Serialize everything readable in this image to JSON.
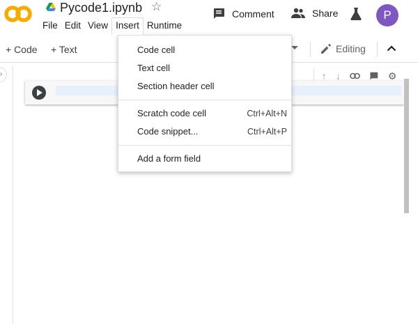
{
  "header": {
    "notebook_title": "Pycode1.ipynb",
    "comment_label": "Comment",
    "share_label": "Share",
    "avatar_letter": "P"
  },
  "menubar": {
    "items": [
      "File",
      "Edit",
      "View",
      "Insert",
      "Runtime"
    ],
    "open_item": "Insert"
  },
  "toolbar": {
    "add_code_label": "+ Code",
    "add_text_label": "+ Text",
    "mode_label": "Editing"
  },
  "insert_menu": {
    "groups": [
      [
        {
          "label": "Code cell",
          "shortcut": ""
        },
        {
          "label": "Text cell",
          "shortcut": ""
        },
        {
          "label": "Section header cell",
          "shortcut": ""
        }
      ],
      [
        {
          "label": "Scratch code cell",
          "shortcut": "Ctrl+Alt+N"
        },
        {
          "label": "Code snippet...",
          "shortcut": "Ctrl+Alt+P"
        }
      ],
      [
        {
          "label": "Add a form field",
          "shortcut": ""
        }
      ]
    ]
  },
  "icons": {
    "logo": "colab-logo",
    "drive": "google-drive-icon",
    "star": "star-outline-icon",
    "comment": "comment-icon",
    "share": "people-icon",
    "lab": "flask-icon",
    "edit": "pencil-icon",
    "collapse": "chevron-up-icon",
    "run": "play-icon",
    "cell_tools": [
      "arrow-up-icon",
      "arrow-down-icon",
      "link-icon",
      "comment-icon",
      "gear-icon"
    ]
  },
  "colors": {
    "logo_orange": "#f9ab00",
    "avatar_bg": "#7e57c2"
  }
}
